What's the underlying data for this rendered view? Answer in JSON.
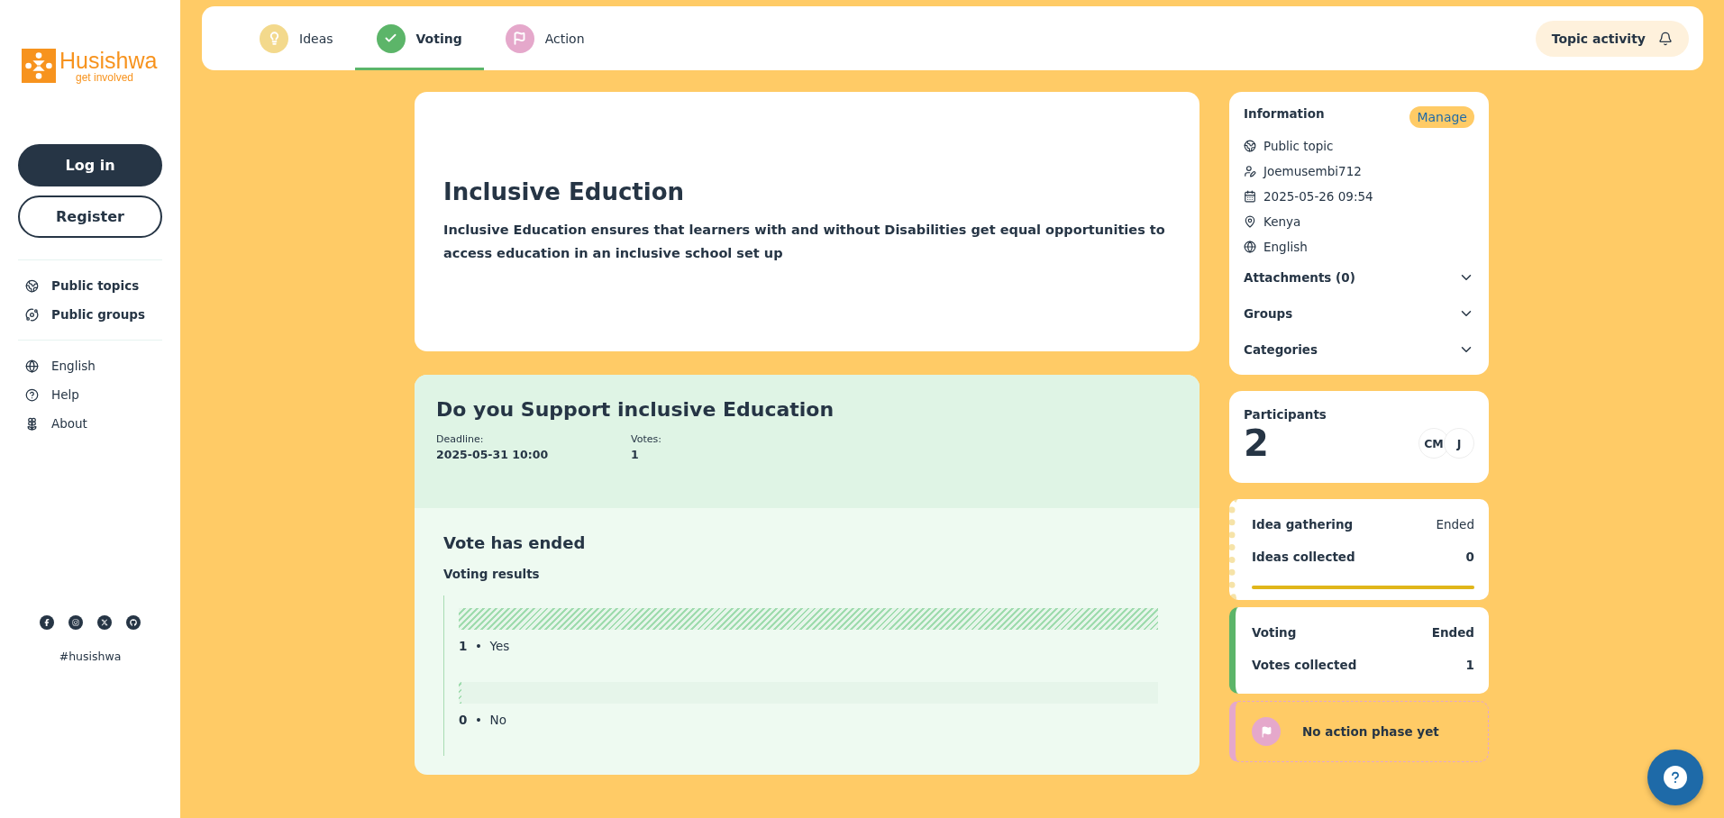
{
  "sidebar": {
    "logo": {
      "name": "Husishwa",
      "tagline": "get involved"
    },
    "auth_buttons": [
      {
        "label": "Log in",
        "kind": "primary"
      },
      {
        "label": "Register",
        "kind": "outline"
      }
    ],
    "nav": [
      {
        "label": "Public topics"
      },
      {
        "label": "Public groups"
      }
    ],
    "links": [
      {
        "label": "English"
      },
      {
        "label": "Help"
      },
      {
        "label": "About"
      }
    ],
    "hashtag": "#husishwa"
  },
  "tabs": [
    {
      "label": "Ideas",
      "color": "#f3d98c",
      "selected": false
    },
    {
      "label": "Voting",
      "color": "#5cb569",
      "selected": true
    },
    {
      "label": "Action",
      "color": "#e5a8cb",
      "selected": false
    }
  ],
  "topic_activity": {
    "label": "Topic activity"
  },
  "topic": {
    "title": "Inclusive Eduction",
    "description": "Inclusive Education ensures that learners with and without Disabilities get equal opportunities to access education in an inclusive school set up"
  },
  "vote": {
    "question": "Do you Support inclusive Education",
    "meta": [
      {
        "label": "Deadline:",
        "value": "2025-05-31 10:00"
      },
      {
        "label": "Votes:",
        "value": "1"
      }
    ],
    "status": "Vote has ended",
    "results_title": "Voting results",
    "options": [
      {
        "count": "1",
        "separator": "•",
        "label": "Yes",
        "level": 1
      },
      {
        "count": "0",
        "separator": "•",
        "label": "No",
        "level": 0
      }
    ]
  },
  "information": {
    "title": "Information",
    "manage": "Manage",
    "items": [
      {
        "text": "Public topic"
      },
      {
        "text": "Joemusembi712"
      },
      {
        "text": "2025-05-26 09:54"
      },
      {
        "text": "Kenya"
      },
      {
        "text": "English"
      }
    ],
    "sections": [
      {
        "label": "Attachments (0)",
        "expanded": false
      },
      {
        "label": "Groups",
        "expanded": false
      },
      {
        "label": "Categories",
        "expanded": false
      }
    ]
  },
  "participants": {
    "title": "Participants",
    "count": "2",
    "avatars": [
      "CM",
      "J"
    ]
  },
  "phases": [
    {
      "kind": "stats",
      "color": "#f6e3a8",
      "active": false,
      "name": "Idea gathering",
      "status": "Ended",
      "stat_label": "Ideas collected",
      "stat_value": "0",
      "level": 1
    },
    {
      "kind": "stats",
      "color": "#5cb569",
      "active": true,
      "name": "Voting",
      "status": "Ended",
      "stat_label": "Votes collected",
      "stat_value": "1"
    },
    {
      "kind": "empty",
      "color": "#e5a8cb",
      "name": "No action phase yet"
    }
  ]
}
